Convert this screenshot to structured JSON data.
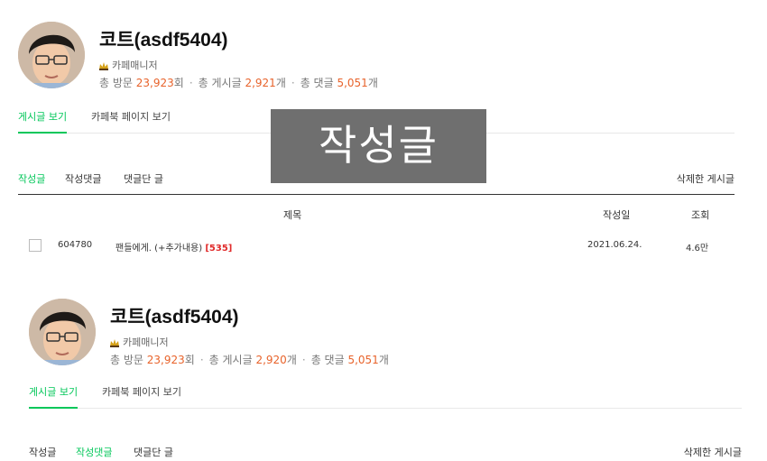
{
  "profile_top": {
    "nickname": "코트(asdf5404)",
    "role": "카페매니저",
    "stats": {
      "visit_label": "총 방문",
      "visit_count": "23,923",
      "visit_unit": "회",
      "posts_label": "총 게시글",
      "posts_count": "2,921",
      "posts_unit": "개",
      "comments_label": "총 댓글",
      "comments_count": "5,051",
      "comments_unit": "개"
    },
    "tabs": [
      "게시글 보기",
      "카페북 페이지 보기"
    ],
    "subtabs": [
      "작성글",
      "작성댓글",
      "댓글단 글"
    ],
    "deleted_posts": "삭제한 게시글",
    "table": {
      "headers": [
        "제목",
        "작성일",
        "조회"
      ],
      "rows": [
        {
          "no": "604780",
          "title": "팬들에게. (+추가내용)",
          "comments": "[535]",
          "date": "2021.06.24.",
          "views": "4.6만"
        }
      ]
    }
  },
  "overlay_text": "작성글",
  "profile_bottom": {
    "nickname": "코트(asdf5404)",
    "role": "카페매니저",
    "stats": {
      "visit_label": "총 방문",
      "visit_count": "23,923",
      "visit_unit": "회",
      "posts_label": "총 게시글",
      "posts_count": "2,920",
      "posts_unit": "개",
      "comments_label": "총 댓글",
      "comments_count": "5,051",
      "comments_unit": "개"
    },
    "tabs": [
      "게시글 보기",
      "카페북 페이지 보기"
    ],
    "subtabs": [
      "작성글",
      "작성댓글",
      "댓글단 글"
    ],
    "deleted_posts": "삭제한 게시글"
  },
  "colors": {
    "accent": "#03c75a",
    "count": "#e8632b",
    "comment_count": "#e02b2b",
    "overlay_bg": "#6f6f6f"
  }
}
